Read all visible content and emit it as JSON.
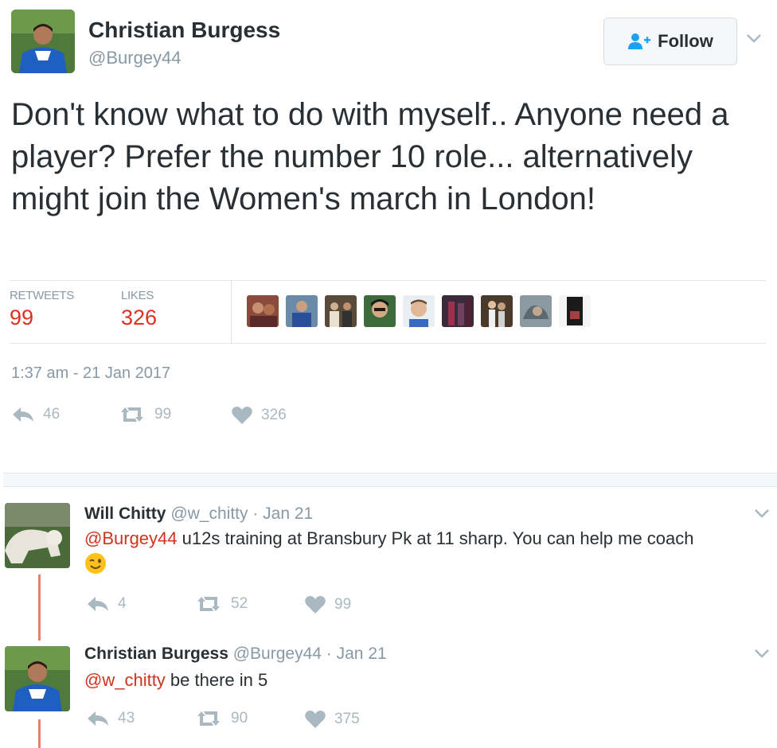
{
  "main_tweet": {
    "author_name": "Christian Burgess",
    "author_handle": "@Burgey44",
    "follow_label": "Follow",
    "text": "Don't know what to do with myself.. Anyone need a player? Prefer the number 10 role... alternatively might join the Women's march in London!",
    "stats": {
      "retweets_label": "RETWEETS",
      "retweets_count": "99",
      "likes_label": "LIKES",
      "likes_count": "326"
    },
    "liker_count": 9,
    "timestamp": "1:37 am - 21 Jan 2017",
    "actions": {
      "reply_count": "46",
      "retweet_count": "99",
      "like_count": "326"
    }
  },
  "replies": [
    {
      "author_name": "Will Chitty",
      "author_handle": "@w_chitty",
      "separator": " · ",
      "date": "Jan 21",
      "mention": "@Burgey44",
      "text": " u12s training at Bransbury Pk at 11 sharp. You can help me coach",
      "emoji": "winking-face-icon",
      "actions": {
        "reply_count": "4",
        "retweet_count": "52",
        "like_count": "99"
      }
    },
    {
      "author_name": "Christian Burgess",
      "author_handle": "@Burgey44",
      "separator": " · ",
      "date": "Jan 21",
      "mention": "@w_chitty",
      "text": " be there in 5",
      "actions": {
        "reply_count": "43",
        "retweet_count": "90",
        "like_count": "375"
      }
    }
  ],
  "colors": {
    "accent_red": "#e0301e",
    "mention_red": "#d0341e",
    "muted_gray": "#8899a6",
    "icon_gray": "#aab8c2",
    "thread_line": "#e8826e"
  }
}
